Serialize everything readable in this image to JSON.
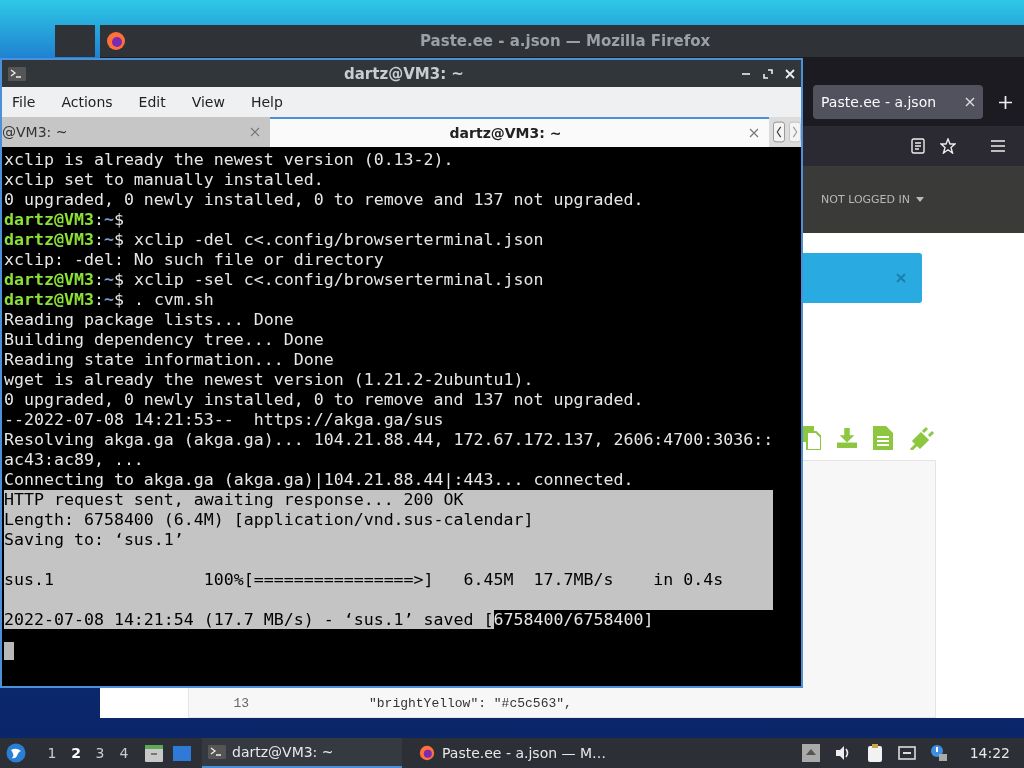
{
  "firefox": {
    "title": "Paste.ee - a.json — Mozilla Firefox",
    "tabs": [
      {
        "label": "Paste.ee - a.json",
        "selected": true
      }
    ],
    "site": {
      "account_menu": "NOT LOGGED IN"
    },
    "code": [
      {
        "line": "13",
        "text": "\"brightYellow\": \"#c5c563\","
      }
    ]
  },
  "terminal": {
    "title": "dartz@VM3: ~",
    "menu": [
      "File",
      "Actions",
      "Edit",
      "View",
      "Help"
    ],
    "tabs": [
      {
        "label": "@VM3: ~",
        "selected": false
      },
      {
        "label": "dartz@VM3: ~",
        "selected": true
      }
    ],
    "lines": [
      {
        "selected": false,
        "segments": [
          {
            "kind": "plain",
            "text": "xclip is already the newest version (0.13-2)."
          }
        ]
      },
      {
        "selected": false,
        "segments": [
          {
            "kind": "plain",
            "text": "xclip set to manually installed."
          }
        ]
      },
      {
        "selected": false,
        "segments": [
          {
            "kind": "plain",
            "text": "0 upgraded, 0 newly installed, 0 to remove and 137 not upgraded."
          }
        ]
      },
      {
        "selected": false,
        "segments": [
          {
            "kind": "user",
            "text": "dartz@VM3"
          },
          {
            "kind": "plain",
            "text": ":"
          },
          {
            "kind": "path",
            "text": "~"
          },
          {
            "kind": "plain",
            "text": "$"
          }
        ]
      },
      {
        "selected": false,
        "segments": [
          {
            "kind": "user",
            "text": "dartz@VM3"
          },
          {
            "kind": "plain",
            "text": ":"
          },
          {
            "kind": "path",
            "text": "~"
          },
          {
            "kind": "plain",
            "text": "$ xclip -del c<.config/browserterminal.json"
          }
        ]
      },
      {
        "selected": false,
        "segments": [
          {
            "kind": "plain",
            "text": "xclip: -del: No such file or directory"
          }
        ]
      },
      {
        "selected": false,
        "segments": [
          {
            "kind": "user",
            "text": "dartz@VM3"
          },
          {
            "kind": "plain",
            "text": ":"
          },
          {
            "kind": "path",
            "text": "~"
          },
          {
            "kind": "plain",
            "text": "$ xclip -sel c<.config/browserterminal.json"
          }
        ]
      },
      {
        "selected": false,
        "segments": [
          {
            "kind": "user",
            "text": "dartz@VM3"
          },
          {
            "kind": "plain",
            "text": ":"
          },
          {
            "kind": "path",
            "text": "~"
          },
          {
            "kind": "plain",
            "text": "$ . cvm.sh"
          }
        ]
      },
      {
        "selected": false,
        "segments": [
          {
            "kind": "plain",
            "text": "Reading package lists... Done"
          }
        ]
      },
      {
        "selected": false,
        "segments": [
          {
            "kind": "plain",
            "text": "Building dependency tree... Done"
          }
        ]
      },
      {
        "selected": false,
        "segments": [
          {
            "kind": "plain",
            "text": "Reading state information... Done"
          }
        ]
      },
      {
        "selected": false,
        "segments": [
          {
            "kind": "plain",
            "text": "wget is already the newest version (1.21.2-2ubuntu1)."
          }
        ]
      },
      {
        "selected": false,
        "segments": [
          {
            "kind": "plain",
            "text": "0 upgraded, 0 newly installed, 0 to remove and 137 not upgraded."
          }
        ]
      },
      {
        "selected": false,
        "segments": [
          {
            "kind": "plain",
            "text": "--2022-07-08 14:21:53--  https://akga.ga/sus"
          }
        ]
      },
      {
        "selected": false,
        "segments": [
          {
            "kind": "plain",
            "text": "Resolving akga.ga (akga.ga)... 104.21.88.44, 172.67.172.137, 2606:4700:3036::"
          }
        ]
      },
      {
        "selected": false,
        "segments": [
          {
            "kind": "plain",
            "text": "ac43:ac89, ..."
          }
        ]
      },
      {
        "selected": false,
        "segments": [
          {
            "kind": "plain",
            "text": "Connecting to akga.ga (akga.ga)|104.21.88.44|:443... connected."
          }
        ]
      },
      {
        "selected": true,
        "segments": [
          {
            "kind": "plain",
            "text": "HTTP request sent, awaiting response... 200 OK"
          }
        ]
      },
      {
        "selected": true,
        "segments": [
          {
            "kind": "plain",
            "text": "Length: 6758400 (6.4M) [application/vnd.sus-calendar]"
          }
        ]
      },
      {
        "selected": true,
        "segments": [
          {
            "kind": "plain",
            "text": "Saving to: ‘sus.1’"
          }
        ]
      },
      {
        "selected": true
      },
      {
        "selected": true,
        "segments": [
          {
            "kind": "plain",
            "text": "sus.1               100%[================>]   6.45M  17.7MB/s    in 0.4s"
          }
        ]
      },
      {
        "selected": true
      },
      {
        "selected": false,
        "segments": [
          {
            "kind": "highlight",
            "text": "2022-07-08 14:21:54 (17.7 MB/s) - ‘sus.1’ saved ["
          },
          {
            "kind": "plain",
            "text": "6758400/6758400]"
          }
        ]
      }
    ],
    "cursor": true
  },
  "taskbar": {
    "workspaces": [
      {
        "label": "1",
        "selected": false
      },
      {
        "label": "2",
        "selected": true
      },
      {
        "label": "3",
        "selected": false
      },
      {
        "label": "4",
        "selected": false
      }
    ],
    "tasks": [
      {
        "label": "dartz@VM3: ~",
        "kind": "terminal",
        "selected": true
      },
      {
        "label": "Paste.ee - a.json — M…",
        "kind": "browser",
        "selected": false
      }
    ],
    "clock": "14:22"
  }
}
